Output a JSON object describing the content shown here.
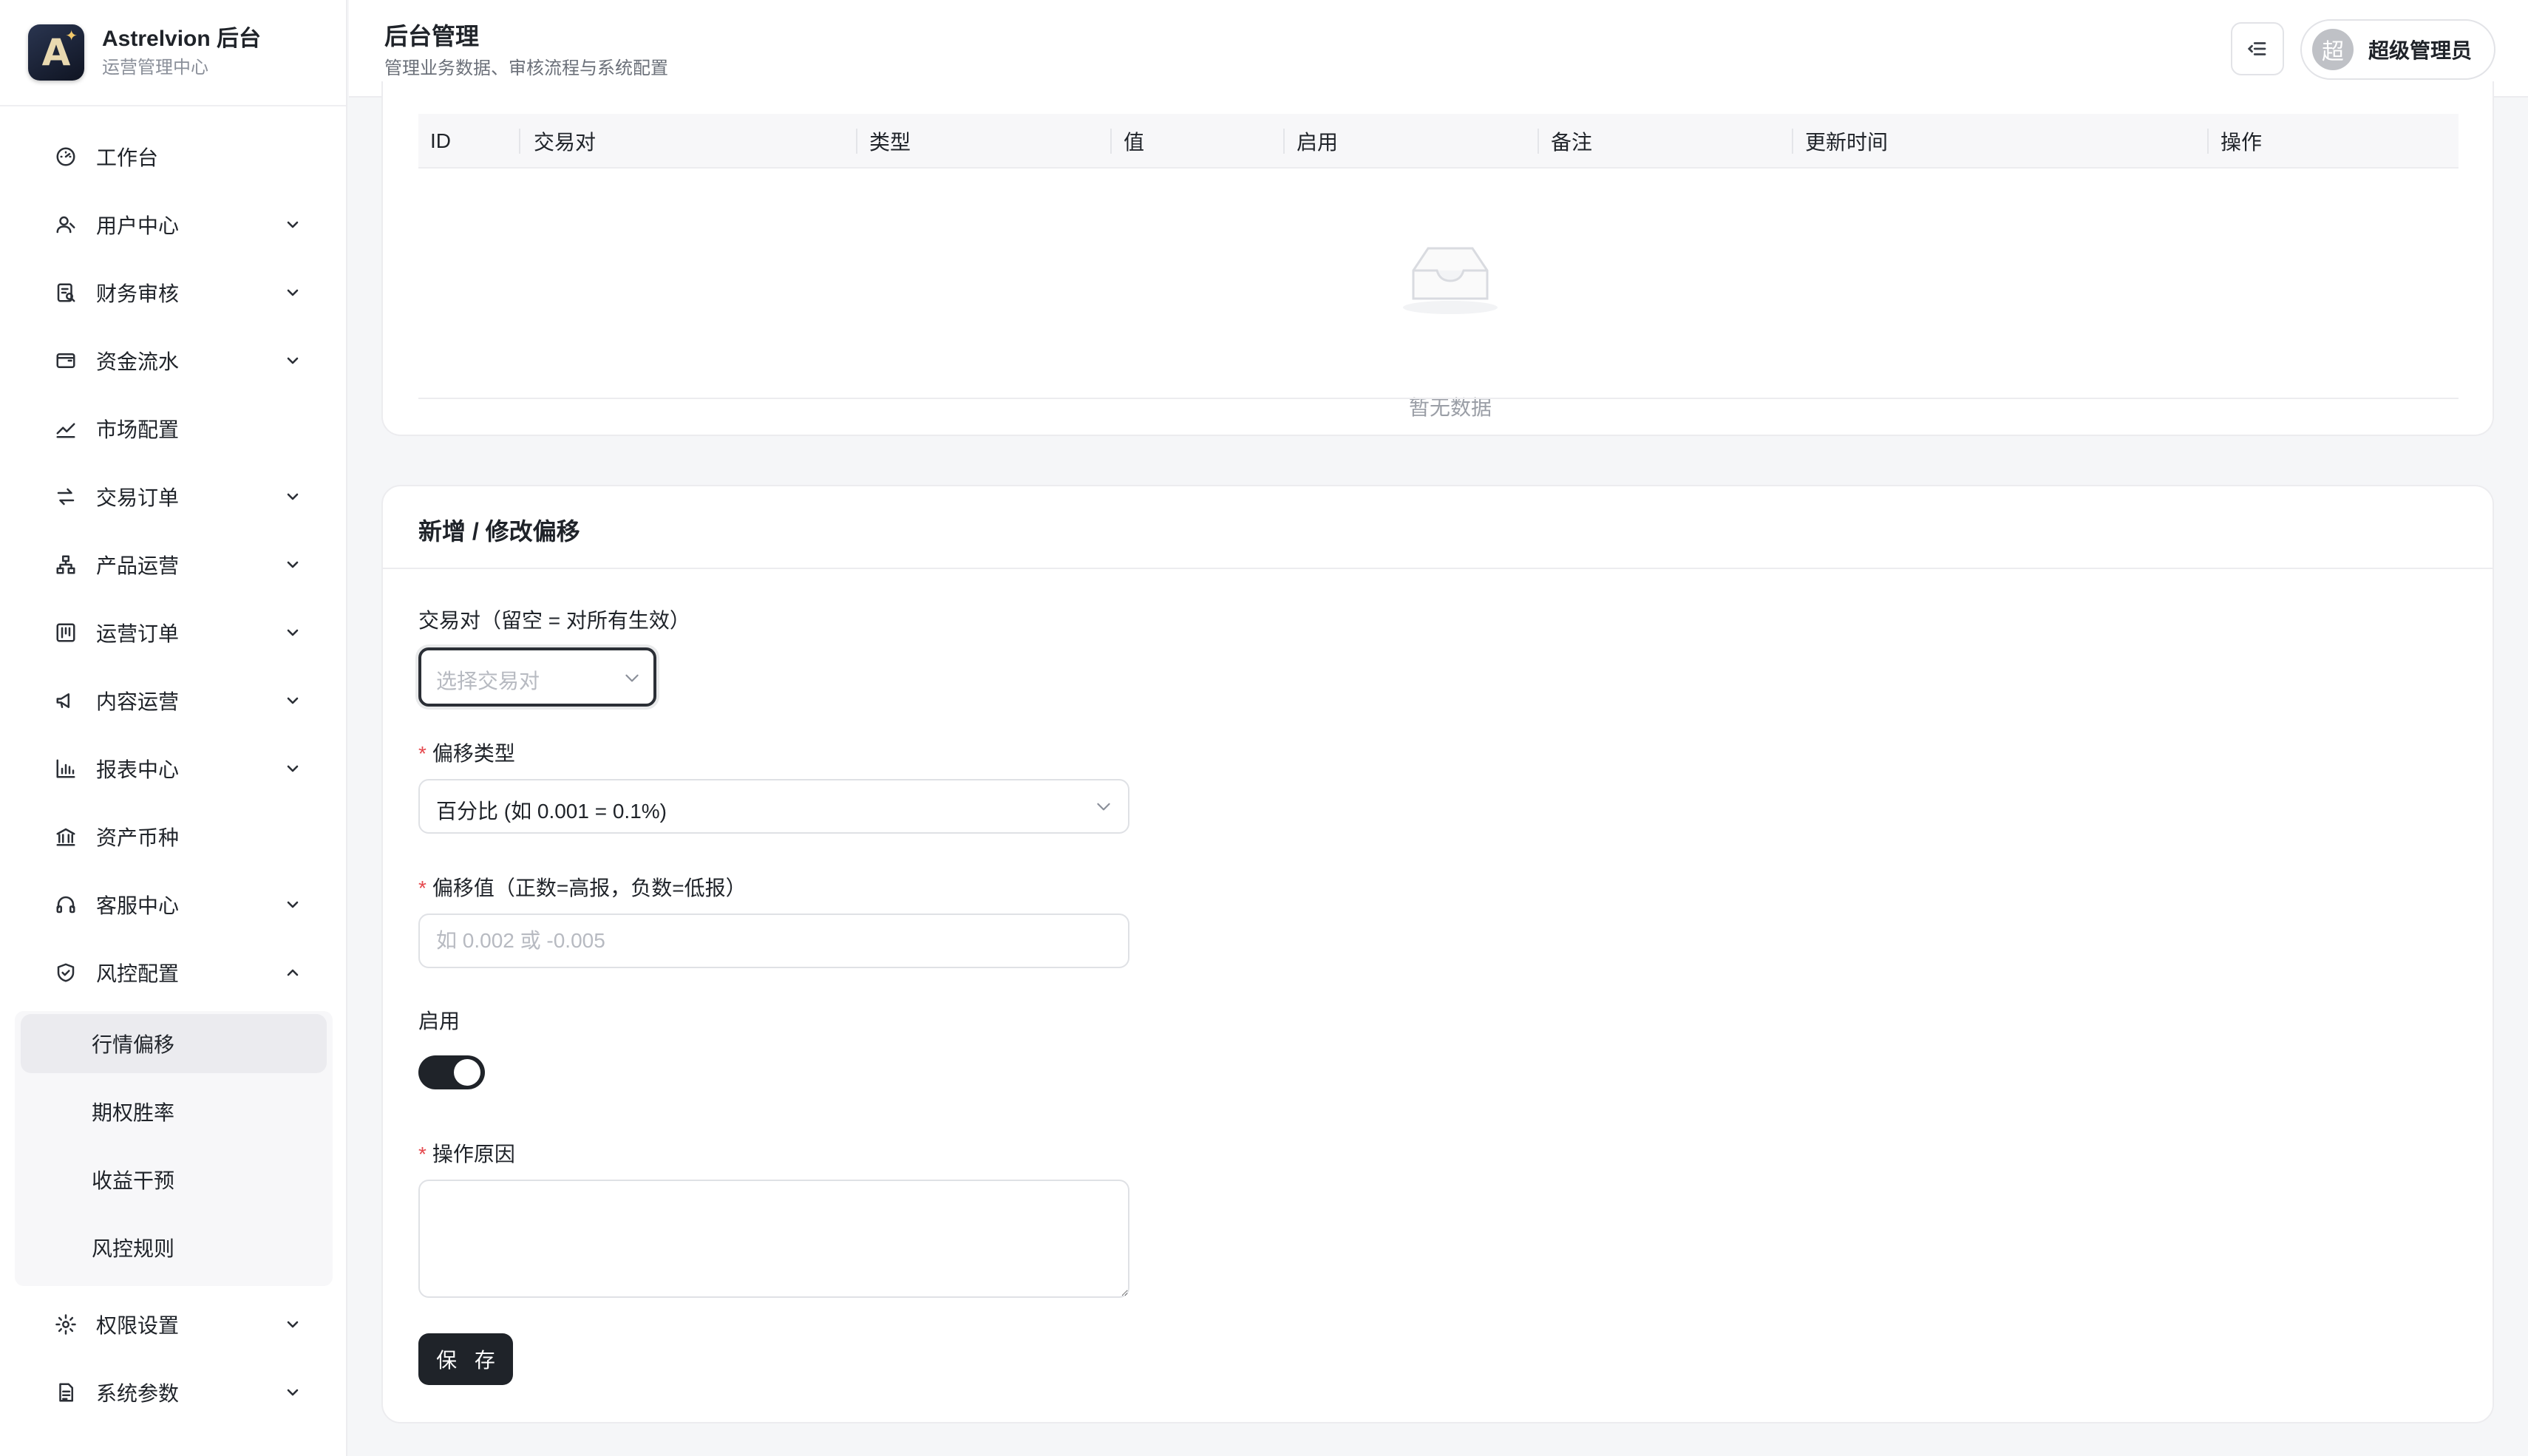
{
  "brand": {
    "title": "Astrelvion 后台",
    "subtitle": "运营管理中心",
    "logo_letter": "A"
  },
  "header": {
    "title": "后台管理",
    "subtitle": "管理业务数据、审核流程与系统配置"
  },
  "user": {
    "avatar_char": "超",
    "name": "超级管理员"
  },
  "nav": {
    "items": [
      {
        "label": "工作台",
        "icon": "dashboard-gauge-icon",
        "expandable": false
      },
      {
        "label": "用户中心",
        "icon": "user-icon",
        "expandable": true
      },
      {
        "label": "财务审核",
        "icon": "finance-audit-icon",
        "expandable": true
      },
      {
        "label": "资金流水",
        "icon": "wallet-icon",
        "expandable": true
      },
      {
        "label": "市场配置",
        "icon": "trend-line-icon",
        "expandable": false
      },
      {
        "label": "交易订单",
        "icon": "swap-arrows-icon",
        "expandable": true
      },
      {
        "label": "产品运营",
        "icon": "sitemap-icon",
        "expandable": true
      },
      {
        "label": "运营订单",
        "icon": "kanban-icon",
        "expandable": true
      },
      {
        "label": "内容运营",
        "icon": "megaphone-icon",
        "expandable": true
      },
      {
        "label": "报表中心",
        "icon": "bar-chart-icon",
        "expandable": true
      },
      {
        "label": "资产币种",
        "icon": "bank-icon",
        "expandable": false
      },
      {
        "label": "客服中心",
        "icon": "headset-icon",
        "expandable": true
      },
      {
        "label": "风控配置",
        "icon": "shield-check-icon",
        "expandable": true,
        "expanded": true
      },
      {
        "label": "权限设置",
        "icon": "gear-icon",
        "expandable": true
      },
      {
        "label": "系统参数",
        "icon": "document-icon",
        "expandable": true
      }
    ],
    "risk_submenu": [
      {
        "label": "行情偏移",
        "active": true
      },
      {
        "label": "期权胜率",
        "active": false
      },
      {
        "label": "收益干预",
        "active": false
      },
      {
        "label": "风控规则",
        "active": false
      }
    ]
  },
  "table": {
    "columns": [
      "ID",
      "交易对",
      "类型",
      "值",
      "启用",
      "备注",
      "更新时间",
      "操作"
    ],
    "rows": [],
    "empty_text": "暂无数据"
  },
  "form": {
    "title": "新增 / 修改偏移",
    "pair": {
      "label": "交易对（留空 = 对所有生效）",
      "placeholder": "选择交易对"
    },
    "type": {
      "label": "偏移类型",
      "value": "百分比 (如 0.001 = 0.1%)"
    },
    "offset": {
      "label": "偏移值（正数=高报，负数=低报）",
      "placeholder": "如 0.002 或 -0.005"
    },
    "enabled": {
      "label": "启用",
      "value": true
    },
    "reason": {
      "label": "操作原因",
      "value": ""
    },
    "save_label": "保 存"
  },
  "colors": {
    "primary": "#1f2329",
    "required": "#e5484d",
    "submenu_bg": "#f7f7f9",
    "active_bg": "#ebebef"
  }
}
